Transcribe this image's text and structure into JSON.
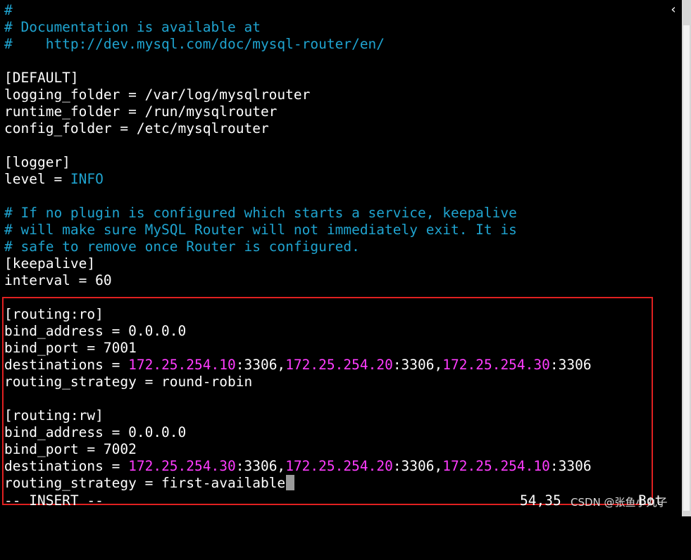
{
  "editor": {
    "lines": [
      {
        "segments": [
          {
            "text": "#",
            "cls": "comment"
          }
        ]
      },
      {
        "segments": [
          {
            "text": "# Documentation is available at",
            "cls": "comment"
          }
        ]
      },
      {
        "segments": [
          {
            "text": "#    http://dev.mysql.com/doc/mysql-router/en/",
            "cls": "comment"
          }
        ]
      },
      {
        "segments": [
          {
            "text": "",
            "cls": ""
          }
        ]
      },
      {
        "segments": [
          {
            "text": "[DEFAULT]",
            "cls": ""
          }
        ]
      },
      {
        "segments": [
          {
            "text": "logging_folder = /var/log/mysqlrouter",
            "cls": ""
          }
        ]
      },
      {
        "segments": [
          {
            "text": "runtime_folder = /run/mysqlrouter",
            "cls": ""
          }
        ]
      },
      {
        "segments": [
          {
            "text": "config_folder = /etc/mysqlrouter",
            "cls": ""
          }
        ]
      },
      {
        "segments": [
          {
            "text": "",
            "cls": ""
          }
        ]
      },
      {
        "segments": [
          {
            "text": "[logger]",
            "cls": ""
          }
        ]
      },
      {
        "segments": [
          {
            "text": "level = ",
            "cls": ""
          },
          {
            "text": "INFO",
            "cls": "keyword"
          }
        ]
      },
      {
        "segments": [
          {
            "text": "",
            "cls": ""
          }
        ]
      },
      {
        "segments": [
          {
            "text": "# If no plugin is configured which starts a service, keepalive",
            "cls": "comment"
          }
        ]
      },
      {
        "segments": [
          {
            "text": "# will make sure MySQL Router will not immediately exit. It is",
            "cls": "comment"
          }
        ]
      },
      {
        "segments": [
          {
            "text": "# safe to remove once Router is configured.",
            "cls": "comment"
          }
        ]
      },
      {
        "segments": [
          {
            "text": "[keepalive]",
            "cls": ""
          }
        ]
      },
      {
        "segments": [
          {
            "text": "interval = 60",
            "cls": ""
          }
        ]
      },
      {
        "segments": [
          {
            "text": "",
            "cls": ""
          }
        ]
      },
      {
        "segments": [
          {
            "text": "[routing:ro]",
            "cls": ""
          }
        ]
      },
      {
        "segments": [
          {
            "text": "bind_address = 0.0.0.0",
            "cls": ""
          }
        ]
      },
      {
        "segments": [
          {
            "text": "bind_port = 7001",
            "cls": ""
          }
        ]
      },
      {
        "segments": [
          {
            "text": "destinations = ",
            "cls": ""
          },
          {
            "text": "172.25.254.10",
            "cls": "ip"
          },
          {
            "text": ":3306,",
            "cls": ""
          },
          {
            "text": "172.25.254.20",
            "cls": "ip"
          },
          {
            "text": ":3306,",
            "cls": ""
          },
          {
            "text": "172.25.254.30",
            "cls": "ip"
          },
          {
            "text": ":3306",
            "cls": ""
          }
        ]
      },
      {
        "segments": [
          {
            "text": "routing_strategy = round-robin",
            "cls": ""
          }
        ]
      },
      {
        "segments": [
          {
            "text": "",
            "cls": ""
          }
        ]
      },
      {
        "segments": [
          {
            "text": "[routing:rw]",
            "cls": ""
          }
        ]
      },
      {
        "segments": [
          {
            "text": "bind_address = 0.0.0.0",
            "cls": ""
          }
        ]
      },
      {
        "segments": [
          {
            "text": "bind_port = 7002",
            "cls": ""
          }
        ]
      },
      {
        "segments": [
          {
            "text": "destinations = ",
            "cls": ""
          },
          {
            "text": "172.25.254.30",
            "cls": "ip"
          },
          {
            "text": ":3306,",
            "cls": ""
          },
          {
            "text": "172.25.254.20",
            "cls": "ip"
          },
          {
            "text": ":3306,",
            "cls": ""
          },
          {
            "text": "172.25.254.10",
            "cls": "ip"
          },
          {
            "text": ":3306",
            "cls": ""
          }
        ]
      },
      {
        "segments": [
          {
            "text": "routing_strategy = first-available",
            "cls": ""
          }
        ],
        "cursor": true
      }
    ]
  },
  "statusbar": {
    "mode": "-- INSERT --",
    "cursor_position": "54,35",
    "scroll_position": "Bot"
  },
  "watermark": "CSDN @张鱼小丸子",
  "icons": {
    "collapse": "chevron-left-icon"
  },
  "colors": {
    "background": "#000000",
    "text": "#ffffff",
    "comment": "#1fa3cf",
    "ip_highlight": "#ff3cff",
    "annotation_box": "#e02020"
  }
}
